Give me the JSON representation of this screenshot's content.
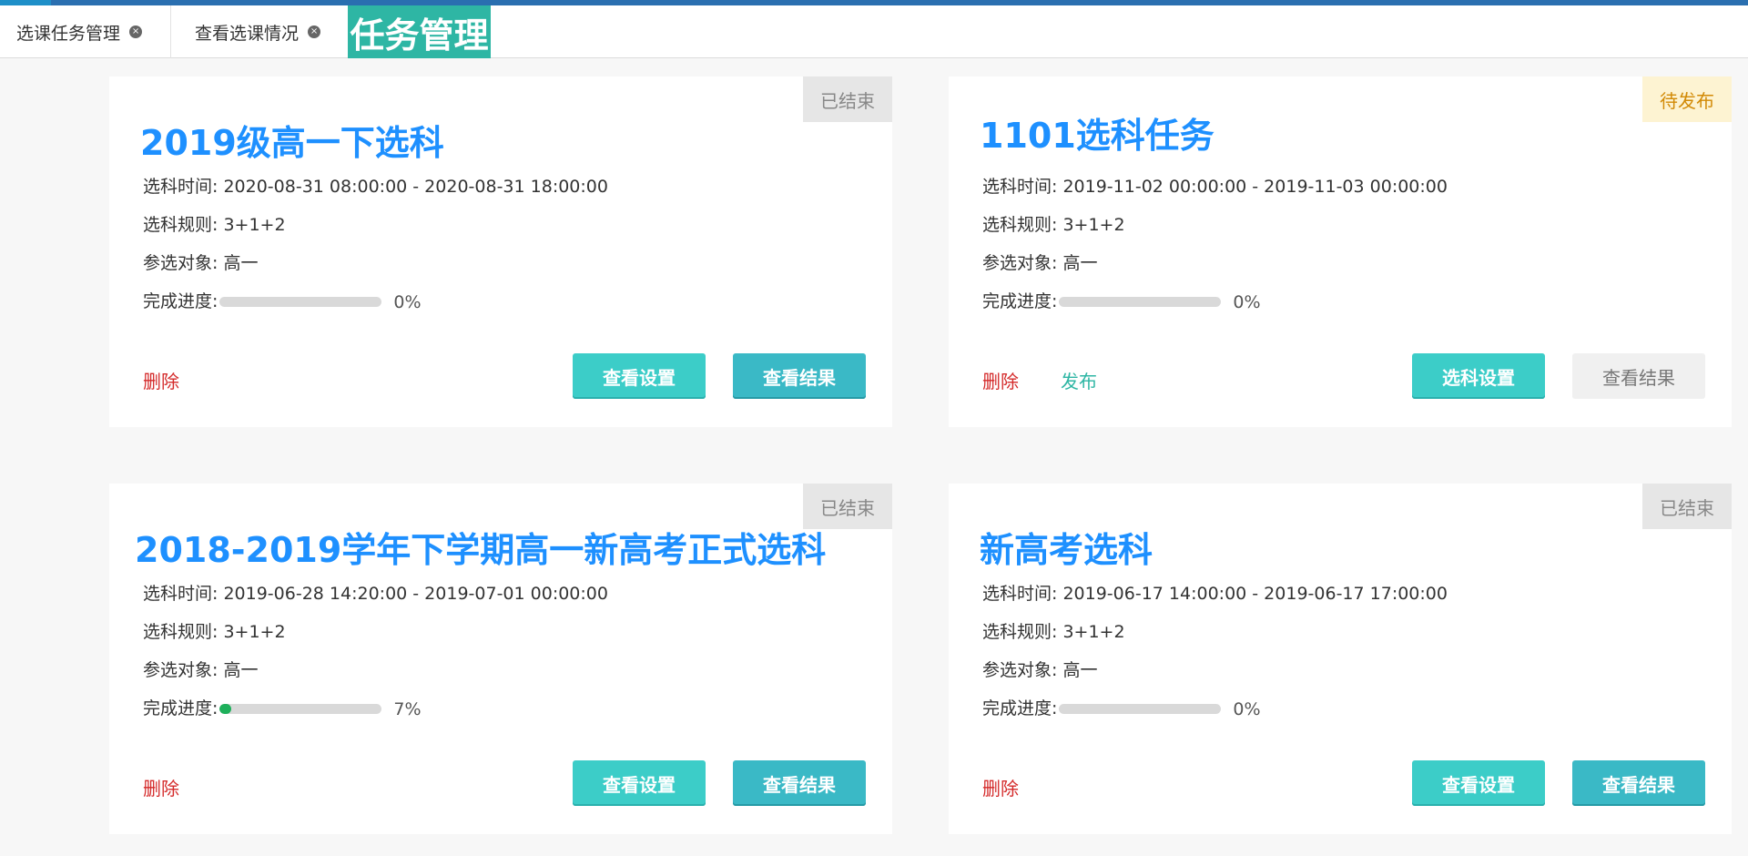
{
  "tabs": [
    {
      "label": "选课任务管理",
      "close": "×"
    },
    {
      "label": "查看选课情况",
      "close": "×"
    }
  ],
  "active_tab": {
    "label": "任务管理"
  },
  "labels": {
    "time": "选科时间: ",
    "rule": "选科规则: ",
    "target": "参选对象: ",
    "progress": "完成进度: "
  },
  "cards": [
    {
      "status": "已结束",
      "title": "2019级高一下选科",
      "time": "2020-08-31 08:00:00 - 2020-08-31 18:00:00",
      "rule": "3+1+2",
      "target": "高一",
      "progress": 0,
      "progress_text": "0%",
      "delete_label": "删除",
      "btn_left": "查看设置",
      "btn_right": "查看结果"
    },
    {
      "status": "待发布",
      "title": "1101选科任务",
      "time": "2019-11-02 00:00:00 - 2019-11-03 00:00:00",
      "rule": "3+1+2",
      "target": "高一",
      "progress": 0,
      "progress_text": "0%",
      "delete_label": "删除",
      "publish_label": "发布",
      "btn_left": "选科设置",
      "btn_right": "查看结果"
    },
    {
      "status": "已结束",
      "title": "2018-2019学年下学期高一新高考正式选科",
      "time": "2019-06-28 14:20:00 - 2019-07-01 00:00:00",
      "rule": "3+1+2",
      "target": "高一",
      "progress": 0.07,
      "progress_text": "7%",
      "delete_label": "删除",
      "btn_left": "查看设置",
      "btn_right": "查看结果"
    },
    {
      "status": "已结束",
      "title": "新高考选科",
      "time": "2019-06-17 14:00:00 - 2019-06-17 17:00:00",
      "rule": "3+1+2",
      "target": "高一",
      "progress": 0,
      "progress_text": "0%",
      "delete_label": "删除",
      "btn_left": "查看设置",
      "btn_right": "查看结果"
    }
  ]
}
